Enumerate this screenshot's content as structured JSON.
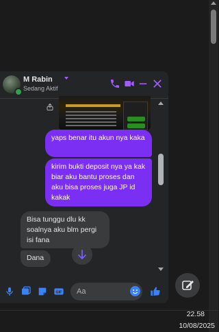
{
  "chat": {
    "contact_name": "M Rabin",
    "contact_status": "Sedang Aktif",
    "messages": {
      "out1": "yaps benar itu akun nya kaka",
      "out2": "kirim bukti deposit nya ya kak biar aku bantu proses dan aku bisa proses juga JP id kakak",
      "in1": "Bisa tunggu dlu kk soalnya aku blm pergi isi fana",
      "in2": "Dana"
    },
    "composer": {
      "placeholder": "Aa"
    }
  },
  "taskbar": {
    "time": "22.58",
    "date": "10/08/2025"
  },
  "colors": {
    "accent": "#a15bff",
    "bubble_out": "#7b2ff2",
    "bubble_in": "#3a3b3c",
    "messenger_blue": "#3b82f6"
  }
}
